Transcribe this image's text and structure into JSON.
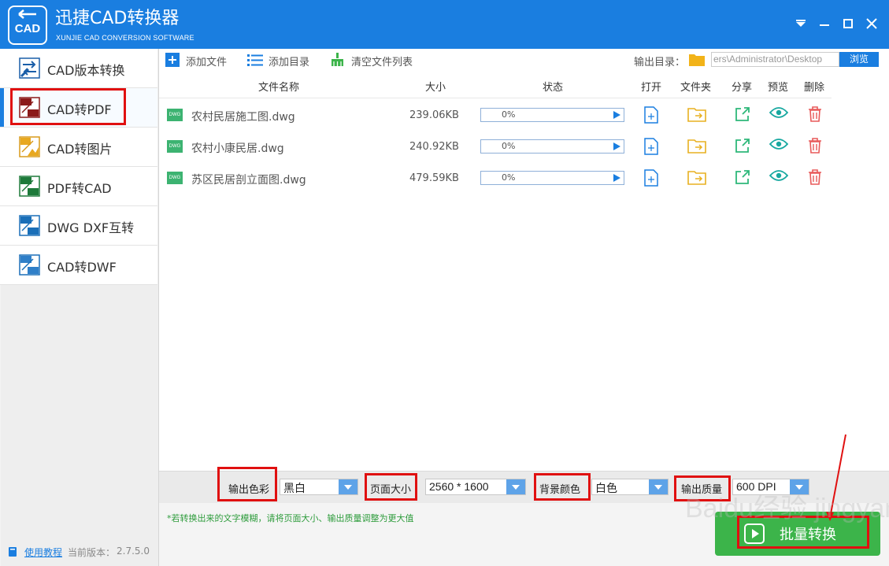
{
  "app": {
    "title": "迅捷CAD转换器",
    "subtitle": "XUNJIE CAD CONVERSION SOFTWARE",
    "logo_text": "CAD"
  },
  "window_controls": [
    "menu-icon",
    "minimize-icon",
    "maximize-icon",
    "close-icon"
  ],
  "sidebar": {
    "items": [
      {
        "label": "CAD版本转换",
        "icon": "cad-version-icon",
        "active": false
      },
      {
        "label": "CAD转PDF",
        "icon": "cad-to-pdf-icon",
        "active": true
      },
      {
        "label": "CAD转图片",
        "icon": "cad-to-image-icon",
        "active": false
      },
      {
        "label": "PDF转CAD",
        "icon": "pdf-to-cad-icon",
        "active": false
      },
      {
        "label": "DWG DXF互转",
        "icon": "dwg-dxf-icon",
        "active": false
      },
      {
        "label": "CAD转DWF",
        "icon": "cad-to-dwf-icon",
        "active": false
      }
    ],
    "help_link": "使用教程",
    "version_label": "当前版本：",
    "version": "2.7.5.0"
  },
  "toolbar": {
    "add_file": "添加文件",
    "add_dir": "添加目录",
    "clear_list": "清空文件列表",
    "output_dir_label": "输出目录：",
    "output_dir_value": "ers\\Administrator\\Desktop",
    "browse": "浏览"
  },
  "table": {
    "headers": {
      "name": "文件名称",
      "size": "大小",
      "status": "状态",
      "open": "打开",
      "folder": "文件夹",
      "share": "分享",
      "preview": "预览",
      "delete": "删除"
    },
    "file_badge": "DWG",
    "rows": [
      {
        "name": "农村民居施工图.dwg",
        "size": "239.06KB",
        "progress_text": "0%",
        "progress": 0
      },
      {
        "name": "农村小康民居.dwg",
        "size": "240.92KB",
        "progress_text": "0%",
        "progress": 0
      },
      {
        "name": "苏区民居剖立面图.dwg",
        "size": "479.59KB",
        "progress_text": "0%",
        "progress": 0
      }
    ]
  },
  "settings": {
    "color_label": "输出色彩",
    "color_value": "黑白",
    "page_size_label": "页面大小",
    "page_size_value": "2560 * 1600",
    "bg_color_label": "背景颜色",
    "bg_color_value": "白色",
    "quality_label": "输出质量",
    "quality_value": "600 DPI"
  },
  "tip": "*若转换出来的文字模糊，请将页面大小、输出质量调整为更大值",
  "convert_button": "批量转换",
  "watermark": "Baidu经验 jingyan.baidu.com",
  "colors": {
    "brand_blue": "#1a7ee0",
    "success_green": "#3cb44a",
    "highlight_red": "#e01010"
  }
}
